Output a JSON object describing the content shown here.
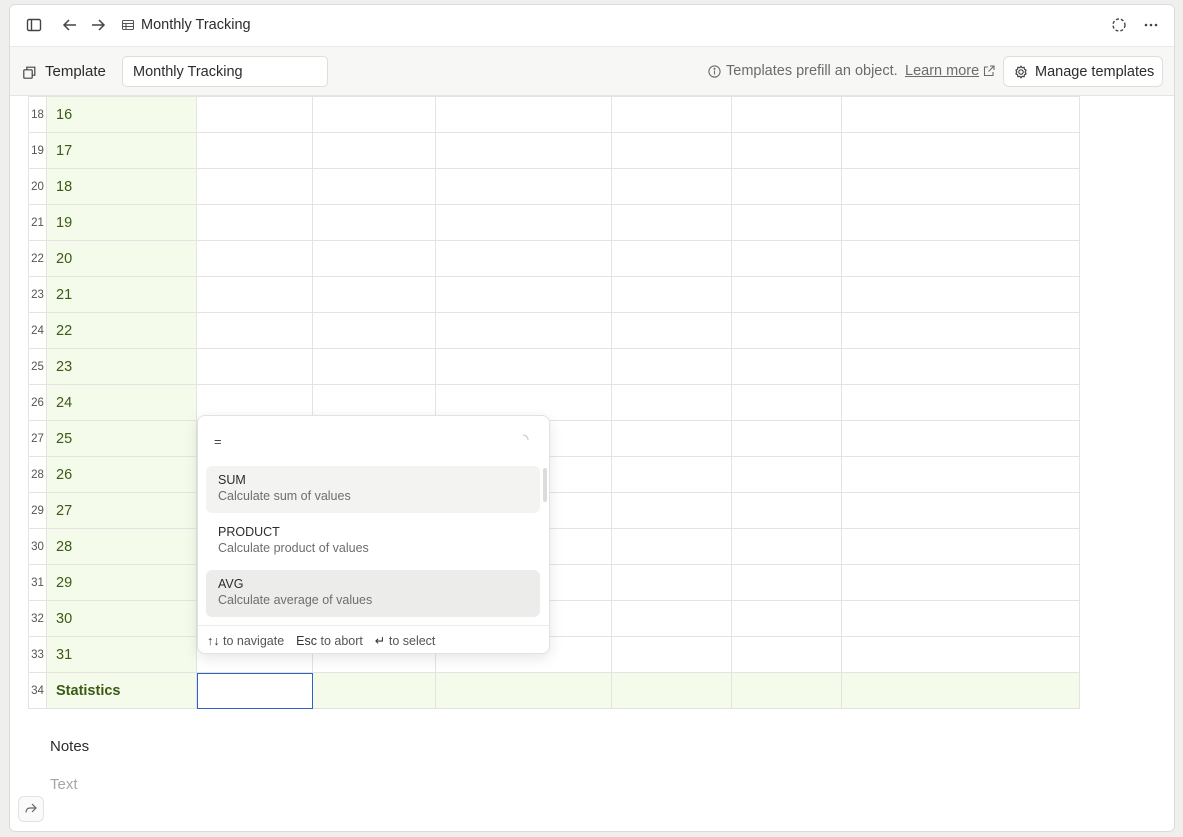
{
  "header": {
    "title": "Monthly Tracking",
    "icons": [
      "sidebar-toggle-icon",
      "back-arrow-icon",
      "forward-arrow-icon",
      "table-icon",
      "sync-icon",
      "more-icon"
    ]
  },
  "template_bar": {
    "label": "Template",
    "name_value": "Monthly Tracking",
    "info_text": "Templates prefill an object.",
    "learn_more": "Learn more",
    "manage_label": "Manage templates"
  },
  "table": {
    "rows": [
      {
        "num": "18",
        "day": "16"
      },
      {
        "num": "19",
        "day": "17"
      },
      {
        "num": "20",
        "day": "18"
      },
      {
        "num": "21",
        "day": "19"
      },
      {
        "num": "22",
        "day": "20"
      },
      {
        "num": "23",
        "day": "21"
      },
      {
        "num": "24",
        "day": "22"
      },
      {
        "num": "25",
        "day": "23"
      },
      {
        "num": "26",
        "day": "24"
      },
      {
        "num": "27",
        "day": "25"
      },
      {
        "num": "28",
        "day": "26"
      },
      {
        "num": "29",
        "day": "27"
      },
      {
        "num": "30",
        "day": "28"
      },
      {
        "num": "31",
        "day": "29"
      },
      {
        "num": "32",
        "day": "30"
      },
      {
        "num": "33",
        "day": "31"
      }
    ],
    "stats_row": {
      "num": "34",
      "label": "Statistics"
    }
  },
  "formula_popup": {
    "input_value": "=",
    "options": [
      {
        "name": "SUM",
        "desc": "Calculate sum of values"
      },
      {
        "name": "PRODUCT",
        "desc": "Calculate product of values"
      },
      {
        "name": "AVG",
        "desc": "Calculate average of values"
      }
    ],
    "footer": {
      "navigate_keys": "↑↓",
      "navigate_text": "to navigate",
      "abort_key": "Esc",
      "abort_text": "to abort",
      "select_key": "↵",
      "select_text": "to select"
    }
  },
  "notes": {
    "title": "Notes",
    "placeholder": "Text"
  }
}
